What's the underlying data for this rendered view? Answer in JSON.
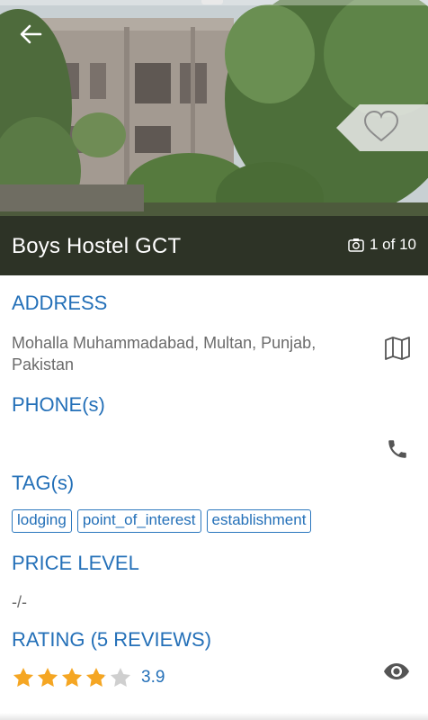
{
  "place": {
    "title": "Boys Hostel GCT",
    "photo_counter": "1 of 10"
  },
  "icons": {
    "back": "arrow-left-icon",
    "favorite": "heart-outline-icon",
    "camera": "camera-icon",
    "map": "map-icon",
    "phone": "phone-icon",
    "view": "eye-icon"
  },
  "address": {
    "heading": "ADDRESS",
    "line1": "Mohalla Muhammadabad, Multan, Punjab,",
    "line2": "Pakistan"
  },
  "phone": {
    "heading": "PHONE(s)",
    "value": ""
  },
  "tags": {
    "heading": "TAG(s)",
    "items": [
      "lodging",
      "point_of_interest",
      "establishment"
    ]
  },
  "price": {
    "heading": "PRICE LEVEL",
    "value": "-/-"
  },
  "rating": {
    "heading": "RATING (5 REVIEWS)",
    "value": "3.9",
    "score": 3.9,
    "max": 5
  },
  "colors": {
    "accent": "#2470b8",
    "star_filled": "#f5a623",
    "star_empty": "#cfcfcf",
    "text_secondary": "#6b6b6b",
    "icon": "#555555"
  }
}
